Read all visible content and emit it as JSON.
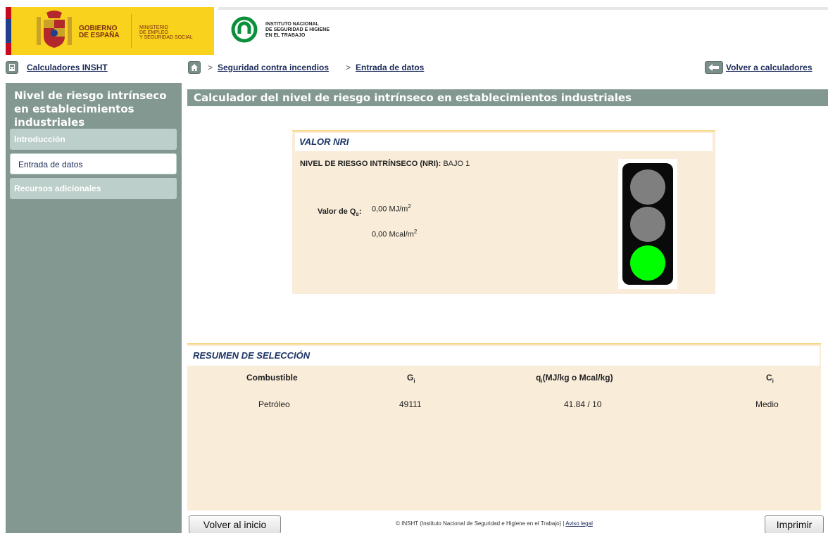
{
  "header": {
    "gov_line1": "GOBIERNO",
    "gov_line2": "DE ESPAÑA",
    "ministry_line1": "MINISTERIO",
    "ministry_line2": "DE EMPLEO",
    "ministry_line3": "Y SEGURIDAD SOCIAL",
    "insht_line1": "INSTITUTO NACIONAL",
    "insht_line2": "DE SEGURIDAD E HIGIENE",
    "insht_line3": "EN EL TRABAJO"
  },
  "nav": {
    "calculators_link": "Calculadores INSHT",
    "breadcrumb_sep1": ">",
    "breadcrumb_item1": "Seguridad contra incendios",
    "breadcrumb_sep2": ">",
    "breadcrumb_item2": "Entrada de datos",
    "back_link": "Volver a calculadores"
  },
  "sidebar": {
    "title": "Nivel de riesgo intrínseco en establecimientos industriales",
    "items": [
      {
        "label": "Introducción",
        "state": "inactive"
      },
      {
        "label": "Entrada de datos",
        "state": "active"
      },
      {
        "label": "Recursos adicionales",
        "state": "inactive"
      }
    ]
  },
  "main": {
    "header": "Calculador del nivel de riesgo intrínseco en establecimientos industriales",
    "nri": {
      "section_title": "VALOR NRI",
      "level_label": "NIVEL DE RIESGO INTRÍNSECO (NRI):",
      "level_value": "BAJO 1",
      "qs_label_main": "Valor de Q",
      "qs_label_sub": "s",
      "qs_label_colon": ":",
      "qs_value1": "0,00 MJ/m",
      "qs_value1_sup": "2",
      "qs_value2": "0,00 Mcal/m",
      "qs_value2_sup": "2",
      "traffic_light_active": "green"
    },
    "summary": {
      "section_title": "RESUMEN DE SELECCIÓN",
      "headers": [
        {
          "main": "Combustible",
          "sub": ""
        },
        {
          "main": "G",
          "sub": "i"
        },
        {
          "main": "q",
          "sub": "i",
          "rest": "(MJ/kg o Mcal/kg)"
        },
        {
          "main": "C",
          "sub": "i"
        }
      ],
      "rows": [
        [
          "Petróleo",
          "49111",
          "41.84 / 10",
          "Medio"
        ]
      ]
    }
  },
  "footer": {
    "back_button": "Volver al inicio",
    "copyright": "© INSHT (Instituto Nacional de Seguridad e Higiene en el Trabajo) |",
    "legal_link": "Aviso legal",
    "print_button": "Imprimir"
  },
  "colors": {
    "sidebar_bg": "#829890",
    "panel_bg": "#f9ecd9",
    "panel_border": "#f7d889",
    "title_blue": "#1c3566",
    "traffic_green": "#00ff00",
    "gov_yellow": "#f8d21c"
  }
}
